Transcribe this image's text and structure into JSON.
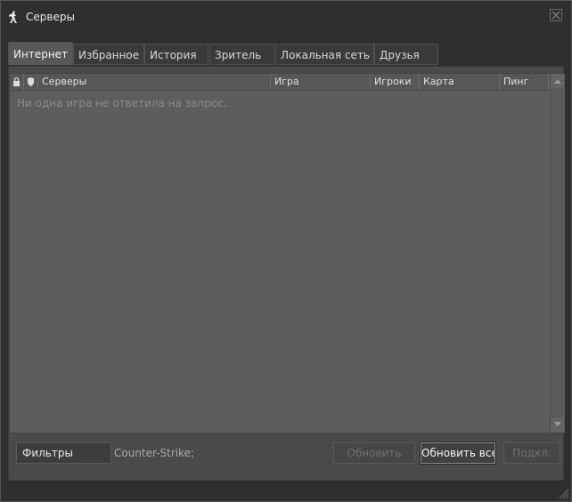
{
  "window": {
    "title": "Серверы",
    "icon": "counter-strike-icon"
  },
  "tabs": [
    {
      "label": "Интернет",
      "active": true
    },
    {
      "label": "Избранное",
      "active": false
    },
    {
      "label": "История",
      "active": false
    },
    {
      "label": "Зритель",
      "active": false
    },
    {
      "label": "Локальная сеть",
      "active": false
    },
    {
      "label": "Друзья",
      "active": false
    }
  ],
  "table": {
    "columns": {
      "lock_icon": "lock-icon",
      "secure_icon": "shield-icon",
      "servers": "Серверы",
      "game": "Игра",
      "players": "Игроки",
      "map": "Карта",
      "ping": "Пинг"
    },
    "empty_message": "Ни одна игра не ответила на запрос."
  },
  "footer": {
    "filters_label": "Фильтры",
    "game_filter": "Counter-Strike;",
    "refresh_label": "Обновить",
    "refresh_all_label": "Обновить все",
    "connect_label": "Подкл."
  },
  "colors": {
    "background": "#2f2f2f",
    "list_background": "#5d5d5d",
    "active_tab": "#585858"
  }
}
